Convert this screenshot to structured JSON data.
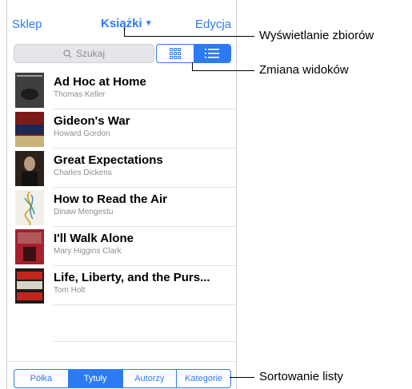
{
  "nav": {
    "left_label": "Sklep",
    "center_label": "Książki",
    "right_label": "Edycja"
  },
  "search": {
    "placeholder": "Szukaj"
  },
  "view_toggle": {
    "options": [
      "grid-icon",
      "list-icon"
    ],
    "selected": "list-icon"
  },
  "books": [
    {
      "title": "Ad Hoc at Home",
      "author": "Thomas Keller"
    },
    {
      "title": "Gideon's War",
      "author": "Howard Gordon"
    },
    {
      "title": "Great Expectations",
      "author": "Charles Dickens"
    },
    {
      "title": "How to Read the Air",
      "author": "Dinaw Mengestu"
    },
    {
      "title": "I'll Walk Alone",
      "author": "Mary Higgins Clark"
    },
    {
      "title": "Life, Liberty, and the Purs...",
      "author": "Tom Holt"
    }
  ],
  "sort": {
    "options": [
      "Półka",
      "Tytuły",
      "Autorzy",
      "Kategorie"
    ],
    "selected": "Tytuły"
  },
  "callouts": {
    "collections": "Wyświetlanie zbiorów",
    "view_change": "Zmiana widoków",
    "sort_list": "Sortowanie listy"
  },
  "colors": {
    "accent": "#2d7bf4",
    "separator": "#e3e3e8",
    "secondary_text": "#8e8e93"
  }
}
